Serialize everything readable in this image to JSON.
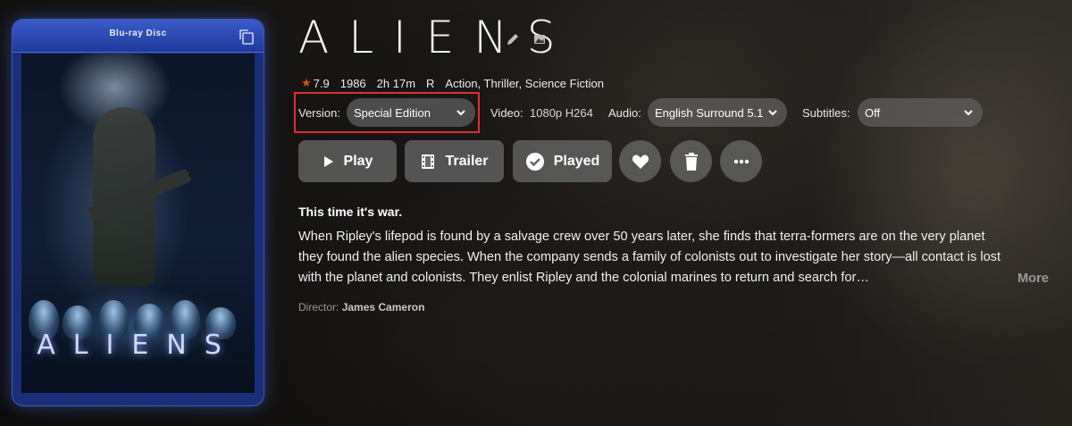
{
  "poster": {
    "brand": "Blu-ray Disc",
    "title": "ALIENS",
    "copy_icon": "copy-icon"
  },
  "title": {
    "logo_text": "ALIENS",
    "edit_icon": "pencil-icon",
    "image_icon": "image-icon"
  },
  "meta": {
    "rating": "7.9",
    "year": "1986",
    "runtime": "2h 17m",
    "certification": "R",
    "genres": "Action, Thriller, Science Fiction",
    "rating_icon": "star-icon"
  },
  "selects": {
    "version_label": "Version:",
    "version_value": "Special Edition",
    "video_label": "Video:",
    "video_value": "1080p H264",
    "audio_label": "Audio:",
    "audio_value": "English Surround 5.1",
    "subtitles_label": "Subtitles:",
    "subtitles_value": "Off"
  },
  "buttons": {
    "play": "Play",
    "trailer": "Trailer",
    "played": "Played",
    "favorite_icon": "heart-icon",
    "delete_icon": "trash-icon",
    "more_icon": "ellipsis-icon"
  },
  "tagline": "This time it's war.",
  "overview": "When Ripley's lifepod is found by a salvage crew over 50 years later, she finds that terra-formers are on the very planet they found the alien species. When the company sends a family of colonists out to investigate her story—all contact is lost with the planet and colonists. They enlist Ripley and the colonial marines to return and search for…",
  "more_label": "More",
  "director": {
    "label": "Director:",
    "name": "James Cameron"
  },
  "colors": {
    "highlight": "#e0302c",
    "star": "#e24a2b",
    "poster_blue": "#1f3a9a"
  }
}
